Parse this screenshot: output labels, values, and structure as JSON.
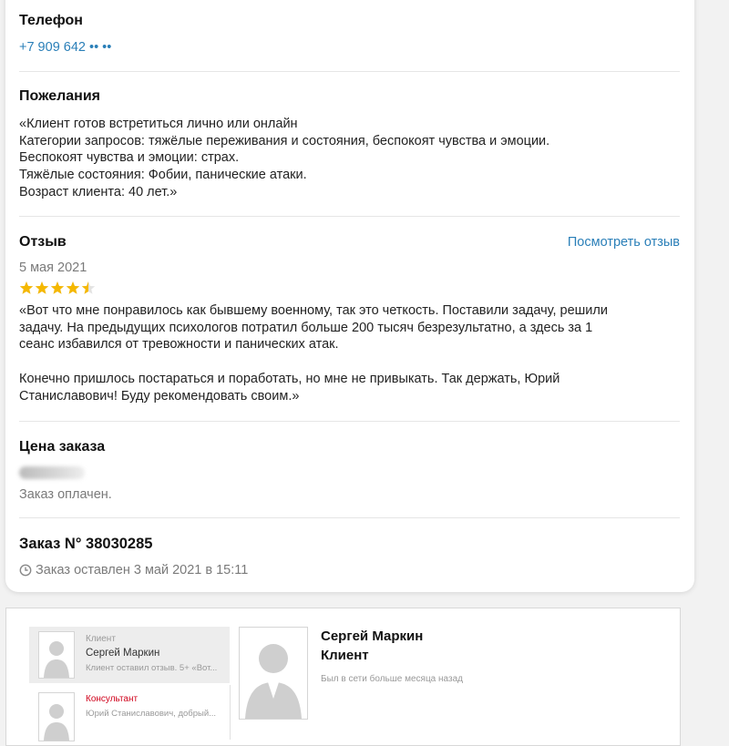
{
  "phone": {
    "heading": "Телефон",
    "value": "+7 909 642 •• ••"
  },
  "wishes": {
    "heading": "Пожелания",
    "lines": [
      "«Клиент готов встретиться лично или онлайн",
      "Категории запросов: тяжёлые переживания и состояния, беспокоят чувства и эмоции.",
      "Беспокоят чувства и эмоции: страх.",
      "Тяжёлые состояния: Фобии, панические атаки.",
      "Возраст клиента: 40 лет.»"
    ]
  },
  "review": {
    "heading": "Отзыв",
    "view_link": "Посмотреть отзыв",
    "date": "5 мая 2021",
    "rating": 4.5,
    "rating_max": 5,
    "star_color": "#f5b800",
    "lines_p1": [
      "«Вот что мне понравилось как бывшему военному, так это четкость. Поставили задачу, решили",
      "задачу. На предыдущих психологов потратил больше 200 тысяч безрезультатно, а здесь за 1",
      "сеанс избавился от тревожности и панических атак."
    ],
    "lines_p2": [
      "Конечно пришлось постараться и поработать, но мне не привыкать. Так держать, Юрий",
      "Станиславович! Буду рекомендовать своим.»"
    ]
  },
  "price": {
    "heading": "Цена заказа",
    "status": "Заказ оплачен."
  },
  "order": {
    "heading": "Заказ N° 38030285",
    "created": "Заказ оставлен 3 май 2021 в 15:11"
  },
  "chat": {
    "items": [
      {
        "role": "Клиент",
        "name": "Сергей Маркин",
        "preview": "Клиент оставил отзыв. 5+ «Вот..."
      },
      {
        "role": "Консультант",
        "preview": "Юрий Станиславович, добрый..."
      }
    ],
    "profile": {
      "name": "Сергей Маркин",
      "role": "Клиент",
      "status": "Был в сети больше месяца назад"
    }
  },
  "colors": {
    "link": "#2a7fb8",
    "consultant_role": "#d0021b",
    "divider": "#e6e6e6"
  }
}
